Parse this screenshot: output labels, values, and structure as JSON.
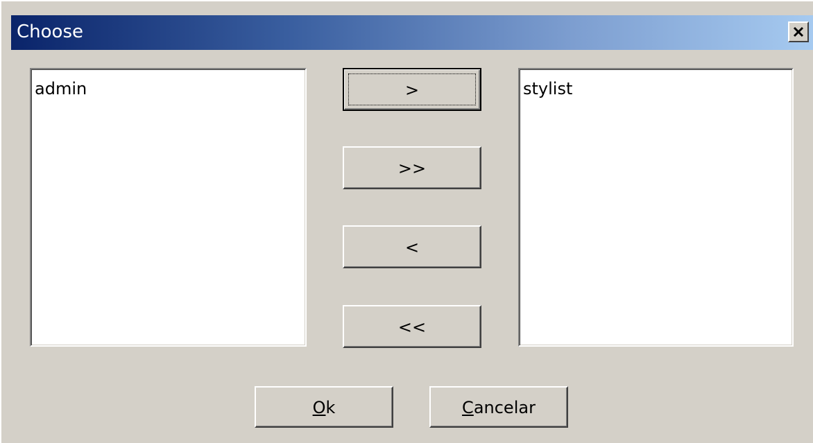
{
  "window": {
    "title": "Choose",
    "close_icon": "close-icon"
  },
  "left_list": {
    "items": [
      "admin"
    ]
  },
  "right_list": {
    "items": [
      "stylist"
    ]
  },
  "transfer_buttons": {
    "move_right": ">",
    "move_all_right": ">>",
    "move_left": "<",
    "move_all_left": "<<"
  },
  "dialog_buttons": {
    "ok": {
      "mnemonic": "O",
      "rest": "k"
    },
    "cancel": {
      "mnemonic": "C",
      "rest": "ancelar"
    }
  },
  "colors": {
    "title_gradient_start": "#0a246a",
    "title_gradient_end": "#a6caf0",
    "face": "#d4d0c8"
  }
}
